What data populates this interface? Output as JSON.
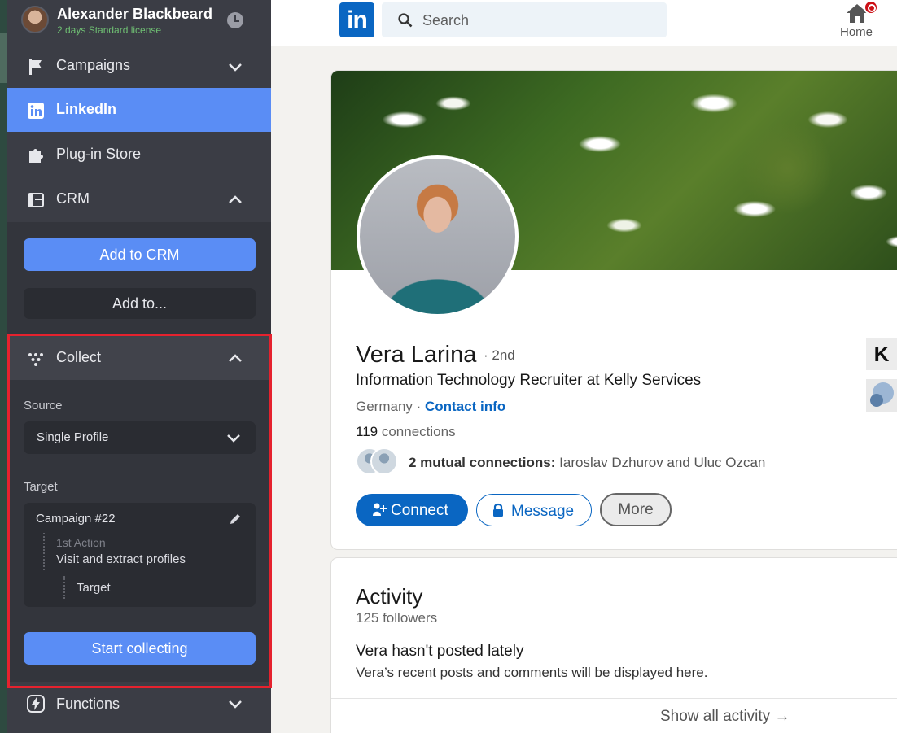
{
  "sidebar": {
    "user": {
      "name": "Alexander Blackbeard",
      "license": "2 days Standard license"
    },
    "nav": {
      "campaigns": "Campaigns",
      "linkedin": "LinkedIn",
      "plugin_store": "Plug-in Store",
      "crm": "CRM",
      "functions": "Functions"
    },
    "crm": {
      "add_to_crm": "Add to CRM",
      "add_to": "Add to..."
    },
    "collect": {
      "title": "Collect",
      "source_label": "Source",
      "source_value": "Single Profile",
      "target_label": "Target",
      "campaign": "Campaign #22",
      "step": "1st Action",
      "action": "Visit and extract profiles",
      "target": "Target",
      "start": "Start collecting"
    }
  },
  "topbar": {
    "logo": "in",
    "search_placeholder": "Search",
    "home_label": "Home"
  },
  "profile": {
    "name": "Vera Larina",
    "degree": "· 2nd",
    "headline": "Information Technology Recruiter at Kelly Services",
    "location": "Germany ·",
    "contact": "Contact info",
    "connections_count": "119",
    "connections_label": "connections",
    "mutual_bold": "2 mutual connections:",
    "mutual_names": "Iaroslav Dzhurov and Uluc Ozcan",
    "buttons": {
      "connect": "Connect",
      "message": "Message",
      "more": "More"
    },
    "side_logo_letter": "K"
  },
  "activity": {
    "title": "Activity",
    "followers": "125 followers",
    "empty_title": "Vera hasn't posted lately",
    "empty_desc": "Vera’s recent posts and comments will be displayed here.",
    "show_all": "Show all activity →"
  },
  "colors": {
    "sidebar_bg": "#3b3d45",
    "accent_blue": "#5a8df5",
    "linkedin_blue": "#0a66c2",
    "highlight_red": "#e5222e",
    "license_green": "#6fbf73"
  }
}
